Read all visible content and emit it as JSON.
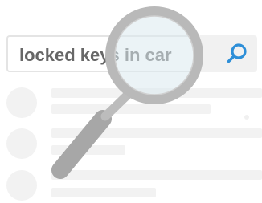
{
  "search": {
    "query": "locked keys in car",
    "icon": "search-icon",
    "accent_color": "#2e8fd8"
  },
  "results": {
    "state": "loading-placeholder",
    "count": 3
  },
  "magnifier": {
    "icon": "magnifying-glass-icon",
    "frame_color": "#b9b9b9",
    "lens_color": "#dbe9ef"
  }
}
